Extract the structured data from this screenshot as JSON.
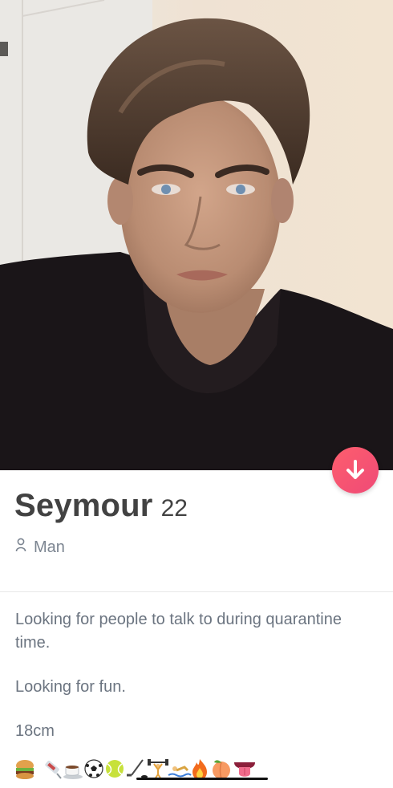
{
  "profile": {
    "name": "Seymour",
    "age": "22",
    "gender": "Man",
    "bio_lines": [
      "Looking for people to talk to during quarantine time.",
      "Looking for fun.",
      "18cm"
    ]
  },
  "icons": {
    "down_button": "arrow-down-icon",
    "gender": "person-icon",
    "emojis": [
      "hamburger",
      "syringe",
      "coffee",
      "soccer-ball",
      "tennis-ball",
      "hockey",
      "weightlifter",
      "swimmer",
      "fire",
      "peach",
      "tongue"
    ]
  },
  "colors": {
    "accent": "#fd5068",
    "name_text": "#424242",
    "secondary_text": "#7c8591"
  }
}
